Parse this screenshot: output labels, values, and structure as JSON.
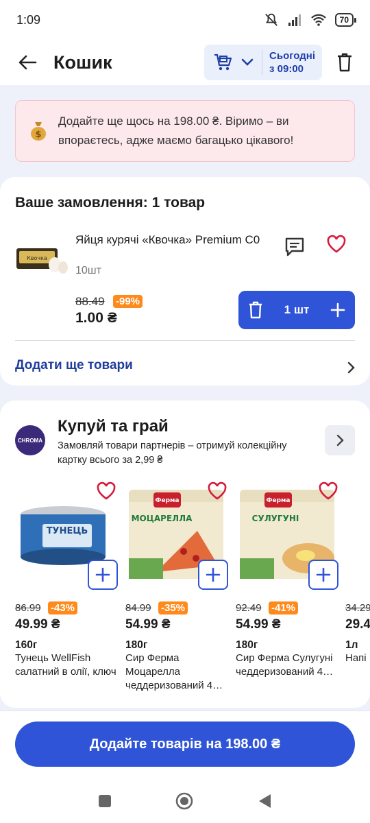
{
  "status_bar": {
    "time": "1:09",
    "battery": "70"
  },
  "header": {
    "title": "Кошик",
    "delivery_line1": "Сьогодні",
    "delivery_line2": "з 09:00"
  },
  "banner": {
    "text": "Додайте ще щось на 198.00 ₴. Віримо – ви впораєтесь, адже маємо багацько цікавого!"
  },
  "order": {
    "title": "Ваше замовлення: 1 товар",
    "item": {
      "name": "Яйця курячі «Квочка» Premium С0",
      "quantity": "10шт",
      "old_price": "88.49",
      "discount": "-99%",
      "price": "1.00 ₴",
      "cart_qty": "1 шт"
    },
    "add_more": "Додати ще товари"
  },
  "promo": {
    "logo_text": "CHROMA",
    "title": "Купуй та грай",
    "subtitle": "Замовляй товари партнерів – отримуй колекційну картку всього за 2,99 ₴",
    "products": [
      {
        "old_price": "86.99",
        "discount": "-43%",
        "price": "49.99 ₴",
        "weight": "160г",
        "name": "Тунець WellFish салатний в олії, ключ",
        "img_label": "ТУНЕЦЬ"
      },
      {
        "old_price": "84.99",
        "discount": "-35%",
        "price": "54.99 ₴",
        "weight": "180г",
        "name": "Сир Ферма Моцарелла чеддеризований 4…",
        "img_label": "МОЦАРЕЛЛА"
      },
      {
        "old_price": "92.49",
        "discount": "-41%",
        "price": "54.99 ₴",
        "weight": "180г",
        "name": "Сир Ферма Сулугуні чеддеризований 4…",
        "img_label": "СУЛУГУНІ"
      },
      {
        "old_price": "34.29",
        "discount": "",
        "price": "29.4",
        "weight": "1л",
        "name": "Напі",
        "img_label": ""
      }
    ]
  },
  "cta": {
    "label": "Додайте товарів на 198.00 ₴"
  },
  "colors": {
    "primary": "#2f54d8",
    "discount": "#ff8a1c",
    "banner_bg": "#fde8ec",
    "heart": "#d81b3c"
  }
}
